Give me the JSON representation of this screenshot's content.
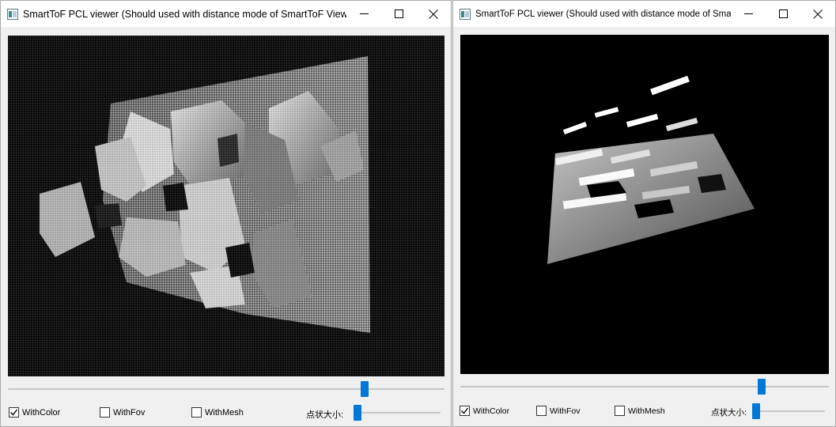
{
  "left_window": {
    "title": "SmartToF PCL viewer (Should used with distance mode of SmartToF Viewer)",
    "main_slider_value": 0.817,
    "checkboxes": [
      {
        "label": "WithColor",
        "checked": true
      },
      {
        "label": "WithFov",
        "checked": false
      },
      {
        "label": "WithMesh",
        "checked": false
      }
    ],
    "point_size_label": "点状大小:",
    "point_size_value": 0.0
  },
  "right_window": {
    "title": "SmartToF PCL viewer (Should used with distance mode of SmartToF Viewer)",
    "main_slider_value": 0.817,
    "checkboxes": [
      {
        "label": "WithColor",
        "checked": true
      },
      {
        "label": "WithFov",
        "checked": false
      },
      {
        "label": "WithMesh",
        "checked": false
      }
    ],
    "point_size_label": "点状大小:",
    "point_size_value": 0.0
  },
  "icons": {
    "app": "app-window-icon",
    "minimize": "minimize-icon",
    "maximize": "maximize-icon",
    "close": "close-icon",
    "check": "check-icon"
  },
  "colors": {
    "accent": "#0078d7",
    "viewport_bg": "#000000",
    "titlebar_bg": "#ffffff",
    "window_bg": "#f0f0f0"
  }
}
